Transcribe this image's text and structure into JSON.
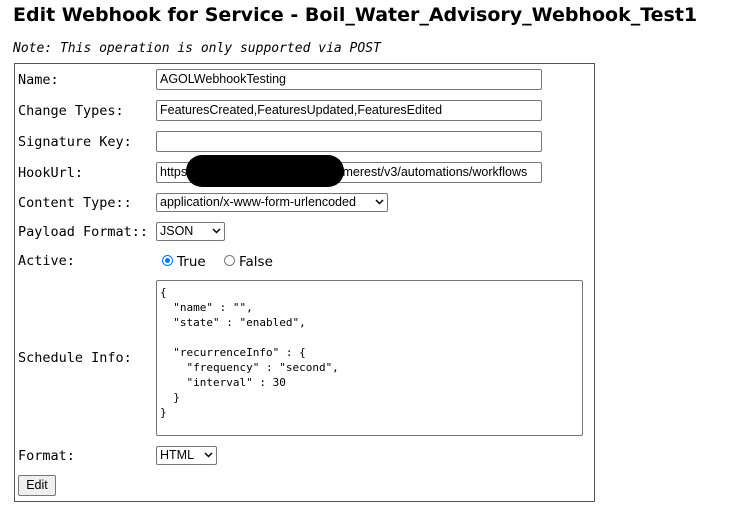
{
  "page": {
    "title": "Edit Webhook for Service - Boil_Water_Advisory_Webhook_Test1",
    "note": "Note: This operation is only supported via POST"
  },
  "form": {
    "name": {
      "label": "Name:",
      "value": "AGOLWebhookTesting"
    },
    "change_types": {
      "label": "Change Types:",
      "value": "FeaturesCreated,FeaturesUpdated,FeaturesEdited"
    },
    "signature_key": {
      "label": "Signature Key:",
      "value": ""
    },
    "hook_url": {
      "label": "HookUrl:",
      "value_prefix": "https:",
      "value_suffix": "fmerest/v3/automations/workflows"
    },
    "content_type": {
      "label": "Content Type::",
      "selected": "application/x-www-form-urlencoded"
    },
    "payload_format": {
      "label": "Payload Format::",
      "selected": "JSON"
    },
    "active": {
      "label": "Active:",
      "options": [
        "True",
        "False"
      ],
      "selected": "True"
    },
    "schedule_info": {
      "label": "Schedule Info:",
      "value": "{\n  \"name\" : \"\",\n  \"state\" : \"enabled\",\n\n  \"recurrenceInfo\" : {\n    \"frequency\" : \"second\",\n    \"interval\" : 30\n  }\n}"
    },
    "format": {
      "label": "Format:",
      "selected": "HTML"
    },
    "submit_label": "Edit"
  },
  "icons": {
    "dropdown": "chevron-down-icon",
    "resize": "resize-grip-icon",
    "radio": "radio-icon"
  },
  "colors": {
    "radio_accent": "#0075ff",
    "redaction": "#000000"
  }
}
